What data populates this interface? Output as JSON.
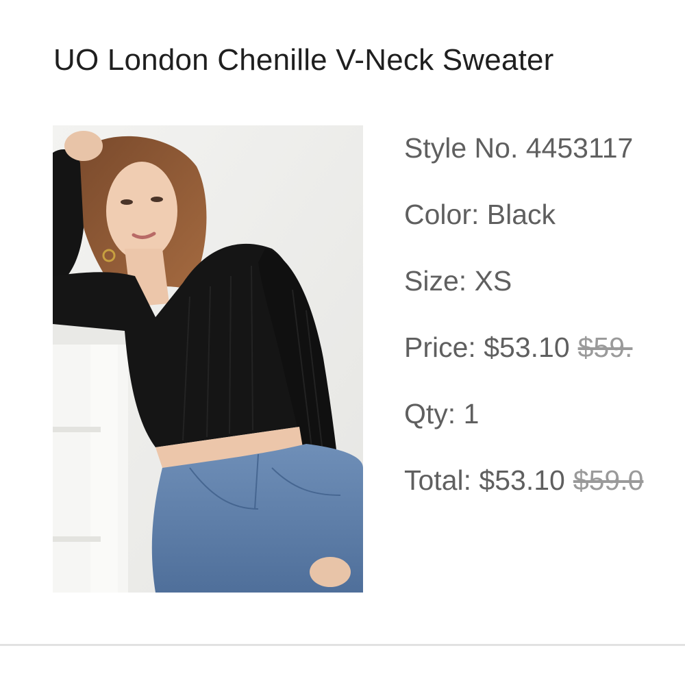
{
  "product": {
    "title": "UO London Chenille V-Neck Sweater",
    "image_alt": "Model wearing black chenille v-neck cropped sweater with blue jeans"
  },
  "details": {
    "style_label": "Style No.",
    "style_value": "4453117",
    "color_label": "Color:",
    "color_value": "Black",
    "size_label": "Size:",
    "size_value": "XS",
    "price_label": "Price:",
    "price_value": "$53.10",
    "price_original": "$59.",
    "qty_label": "Qty:",
    "qty_value": "1",
    "total_label": "Total:",
    "total_value": "$53.10",
    "total_original": "$59.0"
  },
  "colors": {
    "title_text": "#1f1f1f",
    "detail_text": "#5f5f5f",
    "strikethrough_text": "#9a9a9a",
    "divider": "#e2e2e2"
  }
}
